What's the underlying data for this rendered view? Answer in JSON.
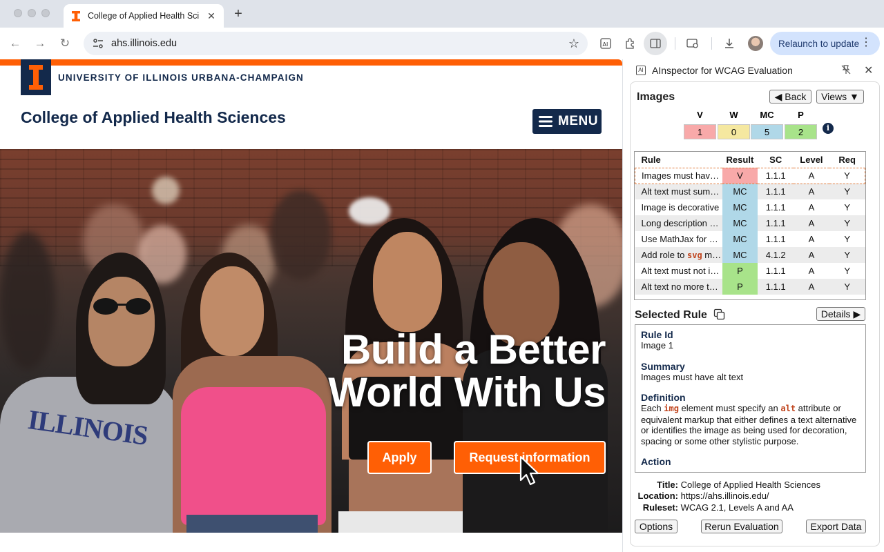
{
  "browser": {
    "tab_title": "College of Applied Health Sci",
    "url": "ahs.illinois.edu",
    "relaunch_label": "Relaunch to update"
  },
  "page": {
    "university": "UNIVERSITY OF ILLINOIS URBANA-CHAMPAIGN",
    "college": "College of Applied Health Sciences",
    "menu_label": "MENU",
    "hero_line1": "Build a Better",
    "hero_line2": "World With Us",
    "apply_label": "Apply",
    "request_label": "Request information",
    "brand_colors": {
      "orange": "#ff5f05",
      "navy": "#13294b"
    }
  },
  "panel": {
    "title": "AInspector for WCAG Evaluation",
    "section": "Images",
    "back_label": "◀ Back",
    "views_label": "Views ▼",
    "summary": [
      {
        "label": "V",
        "value": "1",
        "color": "#f8a9a9"
      },
      {
        "label": "W",
        "value": "0",
        "color": "#f5e8a0"
      },
      {
        "label": "MC",
        "value": "5",
        "color": "#b0d8e8"
      },
      {
        "label": "P",
        "value": "2",
        "color": "#a8e38a"
      }
    ],
    "table_headers": [
      "Rule",
      "Result",
      "SC",
      "Level",
      "Req"
    ],
    "rules": [
      {
        "rule": "Images must have alt text",
        "result": "V",
        "sc": "1.1.1",
        "level": "A",
        "req": "Y"
      },
      {
        "rule": "Alt text must summarize",
        "result": "MC",
        "sc": "1.1.1",
        "level": "A",
        "req": "Y"
      },
      {
        "rule": "Image is decorative",
        "result": "MC",
        "sc": "1.1.1",
        "level": "A",
        "req": "Y"
      },
      {
        "rule": "Long description must",
        "result": "MC",
        "sc": "1.1.1",
        "level": "A",
        "req": "Y"
      },
      {
        "rule": "Use MathJax for math",
        "result": "MC",
        "sc": "1.1.1",
        "level": "A",
        "req": "Y"
      },
      {
        "rule_prefix": "Add role to ",
        "rule_code": "svg",
        "rule_suffix": " markup",
        "result": "MC",
        "sc": "4.1.2",
        "level": "A",
        "req": "Y"
      },
      {
        "rule": "Alt text must not include",
        "result": "P",
        "sc": "1.1.1",
        "level": "A",
        "req": "Y"
      },
      {
        "rule": "Alt text no more than",
        "result": "P",
        "sc": "1.1.1",
        "level": "A",
        "req": "Y"
      }
    ],
    "selected_rule_title": "Selected Rule",
    "details_label": "Details ▶",
    "rule_id_label": "Rule Id",
    "rule_id": "Image 1",
    "summary_label": "Summary",
    "summary_text": "Images must have alt text",
    "definition_label": "Definition",
    "def_1": "Each ",
    "def_code1": "img",
    "def_2": " element must specify an ",
    "def_code2": "alt",
    "def_3": " attribute or equivalent markup that either defines a text alternative or identifies the image as being used for decoration, spacing or some other stylistic purpose.",
    "action_label": "Action",
    "meta_title_label": "Title:",
    "meta_title": "College of Applied Health Sciences",
    "meta_location_label": "Location:",
    "meta_location": "https://ahs.illinois.edu/",
    "meta_ruleset_label": "Ruleset:",
    "meta_ruleset": "WCAG 2.1, Levels A and AA",
    "options_label": "Options",
    "rerun_label": "Rerun Evaluation",
    "export_label": "Export Data"
  }
}
